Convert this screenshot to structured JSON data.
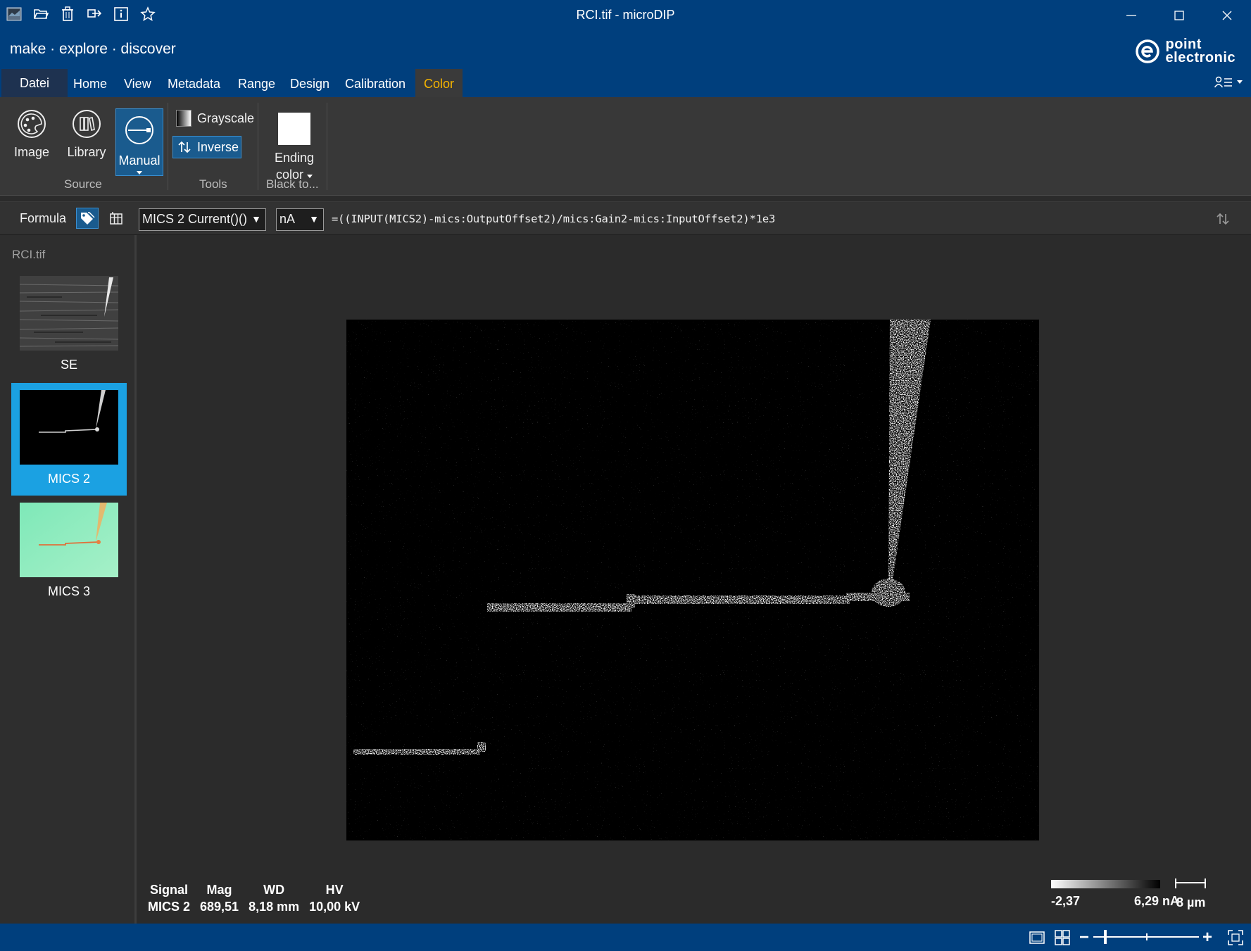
{
  "window": {
    "title": "RCI.tif - microDIP"
  },
  "quick_access": [
    "app-icon",
    "open-icon",
    "delete-icon",
    "export-icon",
    "info-icon",
    "star-icon"
  ],
  "brand": {
    "tagline": "make · explore · discover",
    "logo_line1": "point",
    "logo_line2": "electronic"
  },
  "tabs": {
    "file": "Datei",
    "home": "Home",
    "view": "View",
    "metadata": "Metadata",
    "range": "Range",
    "design": "Design",
    "calibration": "Calibration",
    "color": "Color",
    "active": "Color"
  },
  "ribbon": {
    "image": "Image",
    "library": "Library",
    "manual": "Manual",
    "source_group": "Source",
    "grayscale": "Grayscale",
    "inverse": "Inverse",
    "tools_group": "Tools",
    "ending_line1": "Ending",
    "ending_line2": "color",
    "black_to_group": "Black to...",
    "ending_color_value": "#ffffff"
  },
  "formula": {
    "label": "Formula",
    "signal": "MICS 2 Current()()",
    "unit": "nA",
    "expression": "=((INPUT(MICS2)-mics:OutputOffset2)/mics:Gain2-mics:InputOffset2)*1e3"
  },
  "files": {
    "name": "RCI.tif",
    "channels": [
      {
        "label": "SE",
        "selected": false
      },
      {
        "label": "MICS 2",
        "selected": true
      },
      {
        "label": "MICS 3",
        "selected": false
      }
    ]
  },
  "info": {
    "signal_h": "Signal",
    "signal_v": "MICS 2",
    "mag_h": "Mag",
    "mag_v": "689,51",
    "wd_h": "WD",
    "wd_v": "8,18 mm",
    "hv_h": "HV",
    "hv_v": "10,00 kV"
  },
  "colorscale": {
    "min": "-2,37",
    "max": "6,29 nA"
  },
  "scalebar": {
    "label": "8 µm"
  },
  "colors": {
    "titlebar": "#003f7d",
    "accent": "#1ba1e2",
    "active_tab": "#f5b400"
  }
}
